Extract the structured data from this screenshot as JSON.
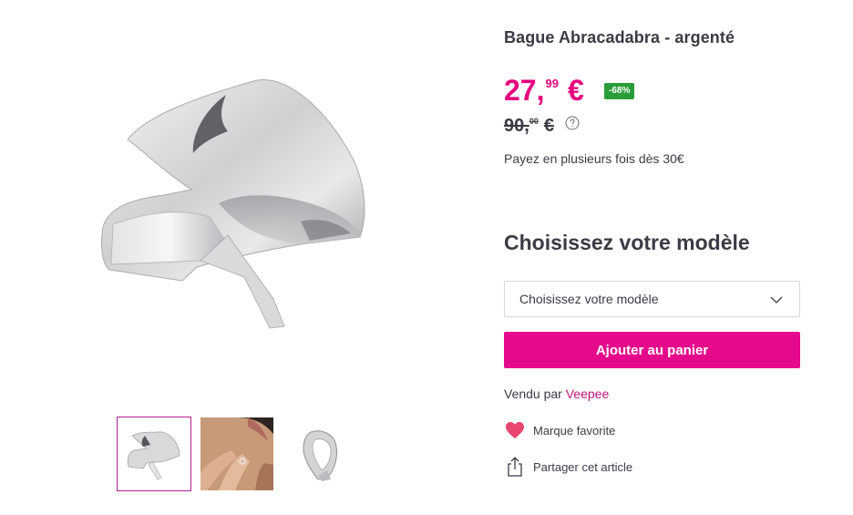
{
  "product": {
    "title": "Bague Abracadabra - argenté",
    "price_int": "27,",
    "price_dec": "99",
    "price_currency": "€",
    "discount": "-68%",
    "old_price_int": "90,",
    "old_price_dec": "00",
    "old_price_currency": "€",
    "installments": "Payez en plusieurs fois dès 30€"
  },
  "model": {
    "heading": "Choisissez votre modèle",
    "select_value": "Choisissez votre modèle"
  },
  "actions": {
    "add_to_cart": "Ajouter au panier",
    "sold_by_prefix": "Vendu par ",
    "seller": "Veepee",
    "favorite_brand": "Marque favorite",
    "share": "Partager cet article"
  },
  "icons": {
    "help": "question-circle-icon",
    "chevron": "chevron-down-icon",
    "heart": "heart-icon",
    "share": "share-icon"
  },
  "colors": {
    "accent_pink": "#e5098b",
    "price_pink": "#e6007e",
    "discount_green": "#2a9d3a",
    "thumb_border": "#b41e8e"
  },
  "gallery": {
    "thumbnail_count": 3,
    "selected_index": 0
  }
}
